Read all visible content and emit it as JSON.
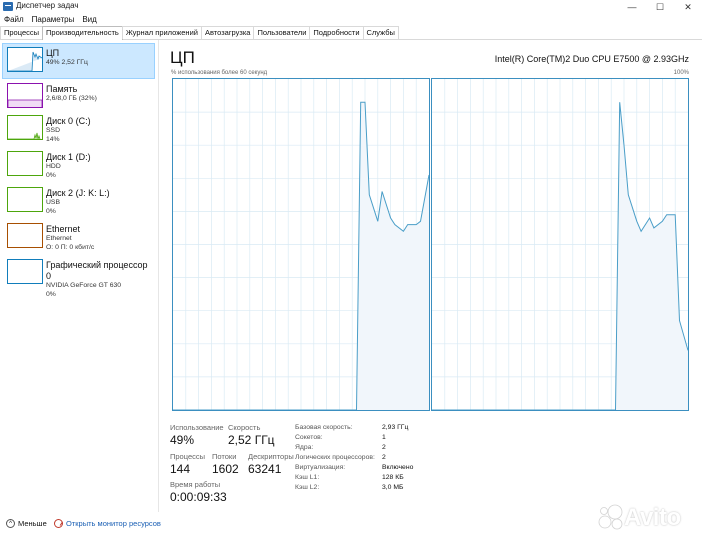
{
  "window": {
    "title": "Диспетчер задач",
    "buttons": {
      "minimize": "—",
      "maximize": "☐",
      "close": "✕"
    }
  },
  "menu": [
    "Файл",
    "Параметры",
    "Вид"
  ],
  "tabs": [
    {
      "label": "Процессы",
      "active": false
    },
    {
      "label": "Производительность",
      "active": true
    },
    {
      "label": "Журнал приложений",
      "active": false
    },
    {
      "label": "Автозагрузка",
      "active": false
    },
    {
      "label": "Пользователи",
      "active": false
    },
    {
      "label": "Подробности",
      "active": false
    },
    {
      "label": "Службы",
      "active": false
    }
  ],
  "sidebar": {
    "items": [
      {
        "name": "ЦП",
        "line1": "49% 2,52 ГГц",
        "line2": "",
        "color": "#117dbb"
      },
      {
        "name": "Память",
        "line1": "2,6/8,0 ГБ (32%)",
        "line2": "",
        "color": "#8b12ae"
      },
      {
        "name": "Диск 0 (C:)",
        "line1": "SSD",
        "line2": "14%",
        "color": "#4da60c"
      },
      {
        "name": "Диск 1 (D:)",
        "line1": "HDD",
        "line2": "0%",
        "color": "#4da60c"
      },
      {
        "name": "Диск 2 (J: K: L:)",
        "line1": "USB",
        "line2": "0%",
        "color": "#4da60c"
      },
      {
        "name": "Ethernet",
        "line1": "Ethernet",
        "line2": "О: 0 П: 0 кбит/с",
        "color": "#a74f01"
      },
      {
        "name": "Графический процессор 0",
        "line1": "NVIDIA GeForce GT 630",
        "line2": "0%",
        "color": "#117dbb"
      }
    ]
  },
  "main": {
    "title": "ЦП",
    "cpu_model": "Intel(R) Core(TM)2 Duo CPU E7500 @ 2.93GHz",
    "util_label": "% использования более 60 секунд",
    "util_max": "100%"
  },
  "chart_data": {
    "type": "area",
    "ylim": [
      0,
      100
    ],
    "xlabel": "% использования более 60 секунд",
    "grid": true,
    "series": [
      {
        "x": [
          0,
          43,
          44,
          45,
          46,
          48,
          49,
          51,
          52,
          54,
          55,
          57,
          58,
          60
        ],
        "values": [
          0,
          0,
          93,
          93,
          65,
          57,
          66,
          58,
          56,
          54,
          56,
          56,
          57,
          71
        ]
      },
      {
        "x": [
          0,
          43,
          44,
          45,
          46,
          48,
          49,
          51,
          52,
          54,
          55,
          57,
          58,
          60
        ],
        "values": [
          0,
          0,
          93,
          80,
          65,
          57,
          54,
          58,
          55,
          57,
          59,
          59,
          27,
          18
        ]
      }
    ],
    "colors": {
      "line": "#4a9ec8",
      "fill": "#f1f6fb",
      "grid": "#d9eaf4",
      "border": "#3b8fc0"
    }
  },
  "stats": {
    "utilization": {
      "label": "Использование",
      "value": "49%"
    },
    "speed": {
      "label": "Скорость",
      "value": "2,52 ГГц"
    },
    "processes": {
      "label": "Процессы",
      "value": "144"
    },
    "threads": {
      "label": "Потоки",
      "value": "1602"
    },
    "handles": {
      "label": "Дескрипторы",
      "value": "63241"
    },
    "uptime": {
      "label": "Время работы",
      "value": "0:00:09:33"
    }
  },
  "details": [
    {
      "label": "Базовая скорость:",
      "value": "2,93 ГГц"
    },
    {
      "label": "Сокетов:",
      "value": "1"
    },
    {
      "label": "Ядра:",
      "value": "2"
    },
    {
      "label": "Логических процессоров:",
      "value": "2"
    },
    {
      "label": "Виртуализация:",
      "value": "Включено"
    },
    {
      "label": "Кэш L1:",
      "value": "128 КБ"
    },
    {
      "label": "Кэш L2:",
      "value": "3,0 МБ"
    }
  ],
  "footer": {
    "less": "Меньше",
    "monitor": "Открыть монитор ресурсов"
  },
  "watermark": {
    "text": "Avito"
  }
}
